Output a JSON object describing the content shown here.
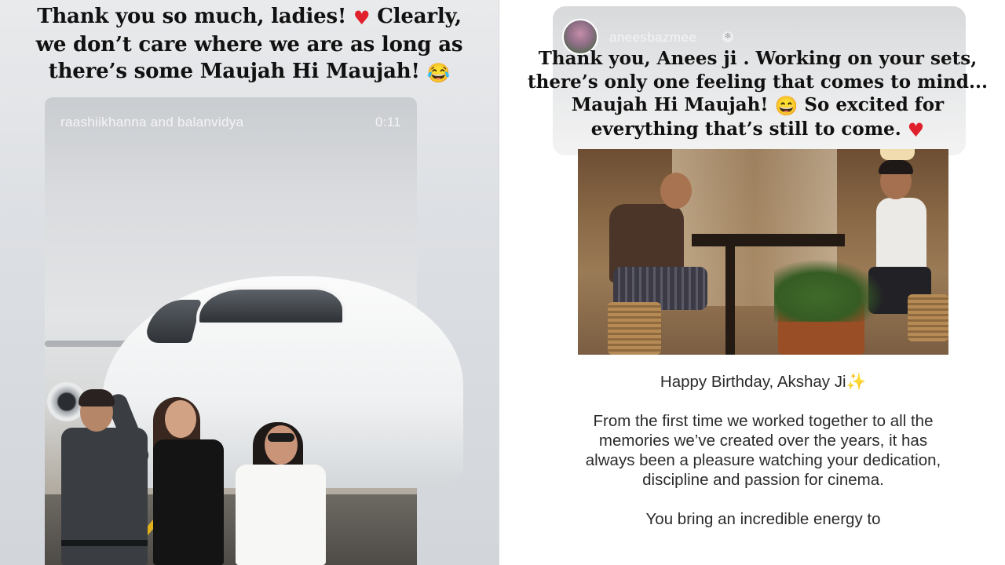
{
  "left_story": {
    "caption_line1": "Thank you so much, ladies!",
    "caption_line1b": "Clearly,",
    "caption_line2": "we don’t care where we are as long as",
    "caption_line3": "there’s some Maujah Hi Maujah!",
    "heart_emoji": "♥",
    "laugh_emoji": "😂",
    "reshare": {
      "accounts": "raashiikhanna and balanvidya",
      "timer": "0:11"
    }
  },
  "right_story": {
    "username": "aneesbazmee",
    "verified_icon": "✻",
    "caption_line1": "Thank you, Anees ji . Working on your sets,",
    "caption_line2": "there’s only one feeling that comes to mind...",
    "caption_line3": "Maujah Hi Maujah!",
    "grin_emoji": "😄",
    "caption_line3b": "So excited for",
    "caption_line4": "everything that’s still to come.",
    "heart_emoji": "♥",
    "post_heading": "Happy Birthday, Akshay Ji",
    "sparkle_emoji": "✨",
    "post_paragraph1": "From the first time we worked together to all the memories we’ve created over the years, it has always been a pleasure watching your dedication, discipline and passion for cinema.",
    "post_paragraph2": "You bring an incredible energy to"
  },
  "colors": {
    "heart": "#e0202c",
    "caption_text": "#111111",
    "post_text": "#2b2b2b"
  }
}
